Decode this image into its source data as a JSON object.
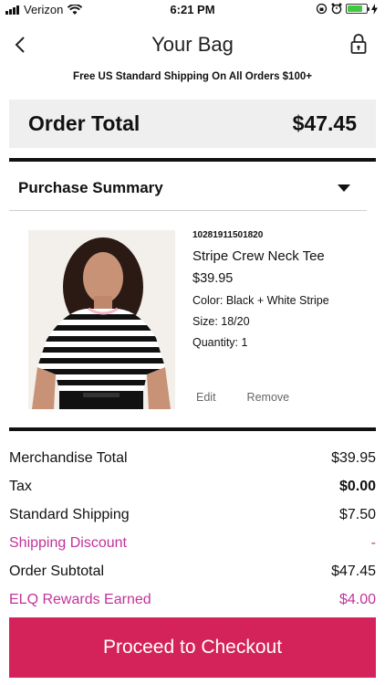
{
  "status_bar": {
    "carrier": "Verizon",
    "time": "6:21 PM"
  },
  "header": {
    "title": "Your Bag",
    "back_icon": "chevron-left-icon",
    "lock_icon": "lock-icon"
  },
  "promo": "Free US Standard Shipping On All Orders $100+",
  "order_total": {
    "label": "Order Total",
    "value": "$47.45"
  },
  "purchase_summary": {
    "title": "Purchase Summary",
    "item": {
      "sku": "10281911501820",
      "name": "Stripe Crew Neck Tee",
      "price": "$39.95",
      "color": "Color: Black + White Stripe",
      "size": "Size: 18/20",
      "quantity": "Quantity: 1",
      "edit_label": "Edit",
      "remove_label": "Remove"
    }
  },
  "totals": {
    "merchandise_label": "Merchandise Total",
    "merchandise_value": "$39.95",
    "tax_label": "Tax",
    "tax_value": "$0.00",
    "shipping_label": "Standard Shipping",
    "shipping_value": "$7.50",
    "discount_label": "Shipping Discount",
    "discount_value": "-",
    "subtotal_label": "Order Subtotal",
    "subtotal_value": "$47.45",
    "rewards_label": "ELQ Rewards Earned",
    "rewards_value": "$4.00"
  },
  "checkout_label": "Proceed to Checkout",
  "colors": {
    "accent": "#d3235a",
    "pink_text": "#c2339a",
    "total_bar_bg": "#efefef"
  }
}
